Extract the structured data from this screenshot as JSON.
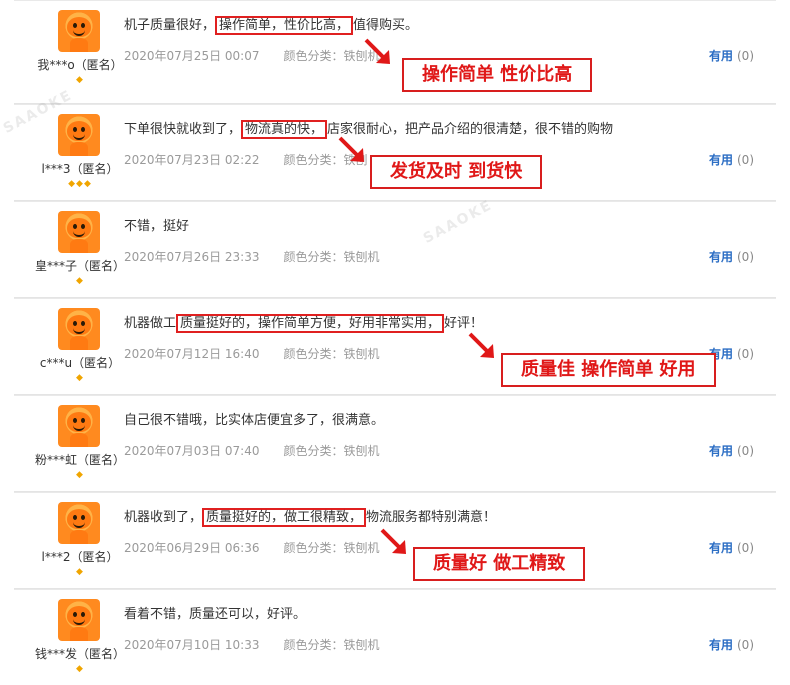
{
  "reviews": [
    {
      "user": "我***o（匿名）",
      "badges": "◆",
      "text_parts": [
        "机子质量很好，",
        "操作简单，性价比高，",
        "值得购买。"
      ],
      "date": "2020年07月25日 00:07",
      "category": "颜色分类：铁刨机",
      "useful": "有用",
      "useful_count": "(0)",
      "callout": "操作简单 性价比高"
    },
    {
      "user": "l***3（匿名）",
      "badges": "◆◆◆",
      "text_parts": [
        "下单很快就收到了，",
        "物流真的快，",
        "店家很耐心，把产品介绍的很清楚，很不错的购物"
      ],
      "date": "2020年07月23日 02:22",
      "category": "颜色分类：铁刨",
      "useful": "有用",
      "useful_count": "(0)",
      "callout": "发货及时 到货快"
    },
    {
      "user": "皇***子（匿名）",
      "badges": "◆",
      "text_parts": [
        "不错，挺好",
        "",
        ""
      ],
      "date": "2020年07月26日 23:33",
      "category": "颜色分类：铁刨机",
      "useful": "有用",
      "useful_count": "(0)",
      "callout": ""
    },
    {
      "user": "c***u（匿名）",
      "badges": "◆",
      "text_parts": [
        "机器做工",
        "质量挺好的，操作简单方便，好用非常实用，",
        "好评！"
      ],
      "date": "2020年07月12日 16:40",
      "category": "颜色分类：铁刨机",
      "useful": "有用",
      "useful_count": "(0)",
      "callout": "质量佳 操作简单 好用"
    },
    {
      "user": "粉***虹（匿名）",
      "badges": "◆",
      "text_parts": [
        "自己很不错哦，比实体店便宜多了，很满意。",
        "",
        ""
      ],
      "date": "2020年07月03日 07:40",
      "category": "颜色分类：铁刨机",
      "useful": "有用",
      "useful_count": "(0)",
      "callout": ""
    },
    {
      "user": "l***2（匿名）",
      "badges": "◆",
      "text_parts": [
        "机器收到了，",
        "质量挺好的，做工很精致，",
        "物流服务都特别满意！"
      ],
      "date": "2020年06月29日 06:36",
      "category": "颜色分类：铁刨机",
      "useful": "有用",
      "useful_count": "(0)",
      "callout": "质量好 做工精致"
    },
    {
      "user": "钱***发（匿名）",
      "badges": "◆",
      "text_parts": [
        "看着不错，质量还可以，好评。",
        "",
        ""
      ],
      "date": "2020年07月10日 10:33",
      "category": "颜色分类：铁刨机",
      "useful": "有用",
      "useful_count": "(0)",
      "callout": ""
    }
  ],
  "watermark": "SAAOKE",
  "colors": {
    "highlight": "#e02020",
    "link": "#2c6ec4",
    "badge": "#f0a500"
  }
}
